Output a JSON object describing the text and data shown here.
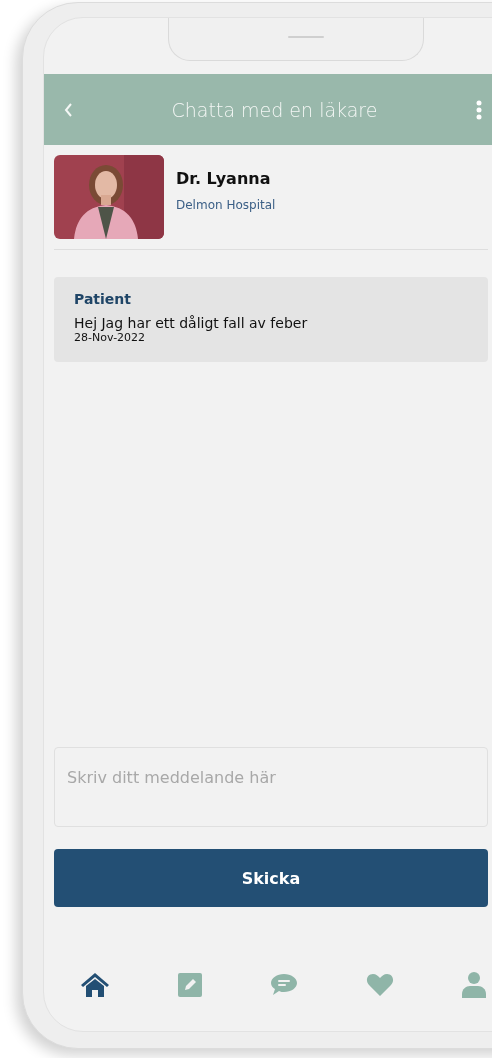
{
  "header": {
    "title": "Chatta med en läkare"
  },
  "doctor": {
    "name": "Dr. Lyanna",
    "hospital": "Delmon Hospital"
  },
  "messages": [
    {
      "sender": "Patient",
      "text": "Hej Jag har ett dåligt fall av feber",
      "date": "28-Nov-2022"
    }
  ],
  "composer": {
    "placeholder": "Skriv ditt meddelande här"
  },
  "send_button": "Skicka",
  "nav": [
    {
      "kind": "home",
      "selected": true
    },
    {
      "kind": "edit",
      "selected": false
    },
    {
      "kind": "chat",
      "selected": false
    },
    {
      "kind": "heart",
      "selected": false
    },
    {
      "kind": "user",
      "selected": false
    }
  ]
}
